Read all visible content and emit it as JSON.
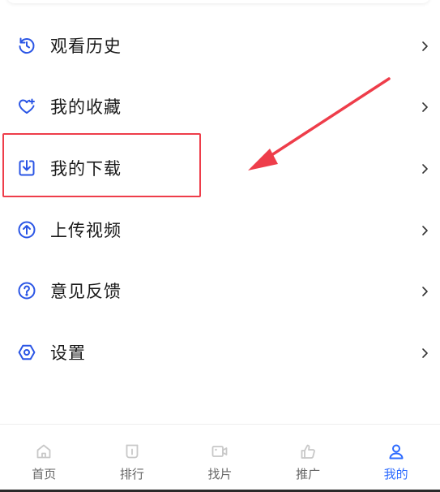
{
  "menu": {
    "items": [
      {
        "label": "观看历史",
        "icon": "history-icon"
      },
      {
        "label": "我的收藏",
        "icon": "heart-icon"
      },
      {
        "label": "我的下载",
        "icon": "download-icon"
      },
      {
        "label": "上传视频",
        "icon": "upload-icon"
      },
      {
        "label": "意见反馈",
        "icon": "help-icon"
      },
      {
        "label": "设置",
        "icon": "settings-icon"
      }
    ]
  },
  "tabs": [
    {
      "label": "首页",
      "icon": "home-icon",
      "active": false
    },
    {
      "label": "排行",
      "icon": "ranking-icon",
      "active": false
    },
    {
      "label": "找片",
      "icon": "video-camera-icon",
      "active": false
    },
    {
      "label": "推广",
      "icon": "thumbs-up-icon",
      "active": false
    },
    {
      "label": "我的",
      "icon": "user-icon",
      "active": true
    }
  ],
  "colors": {
    "accent": "#2d6bff",
    "icon_blue": "#2a55e5",
    "annotation_red": "#ee3d4a",
    "tab_inactive": "#c8c8c8",
    "text": "#1a1a1a"
  }
}
